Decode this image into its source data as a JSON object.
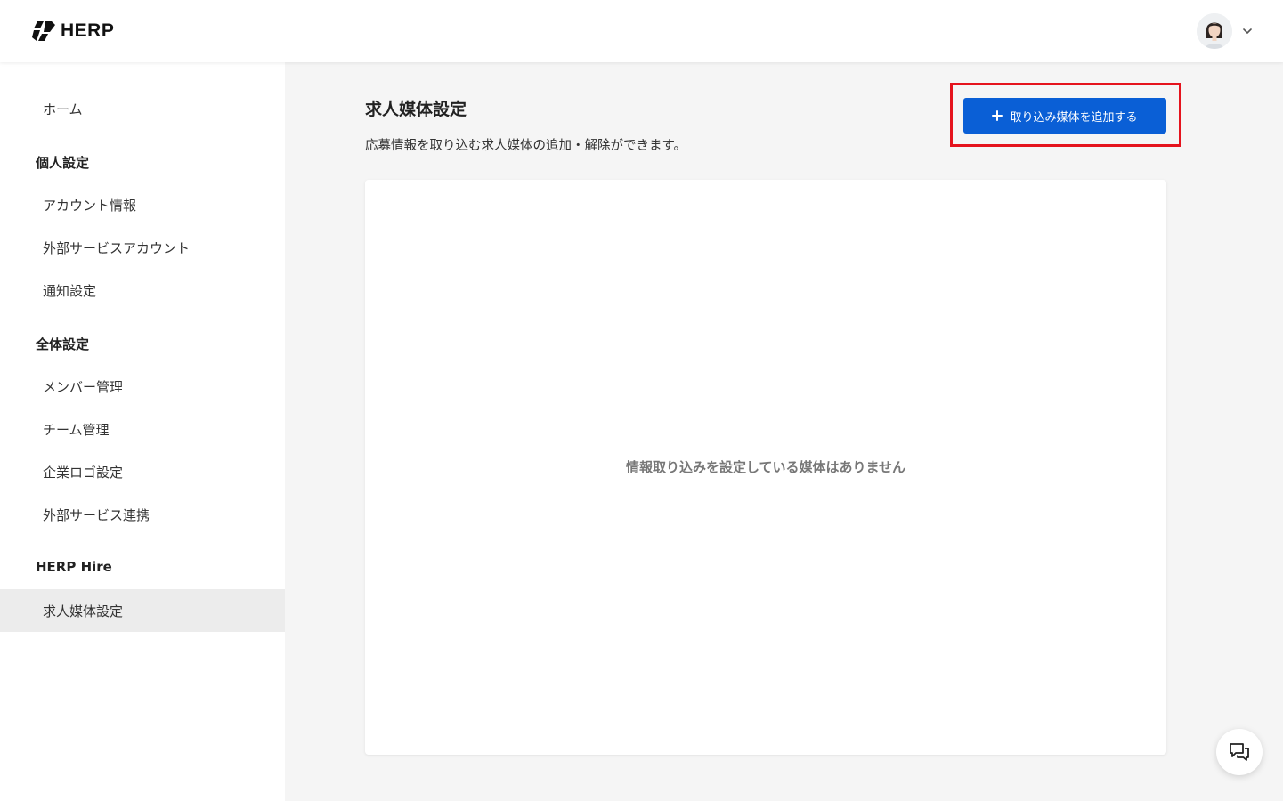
{
  "header": {
    "logo_text": "HERP",
    "user_menu_icon": "chevron-down-icon"
  },
  "sidebar": {
    "home_label": "ホーム",
    "personal_settings": {
      "heading": "個人設定",
      "items": [
        "アカウント情報",
        "外部サービスアカウント",
        "通知設定"
      ]
    },
    "global_settings": {
      "heading": "全体設定",
      "items": [
        "メンバー管理",
        "チーム管理",
        "企業ロゴ設定",
        "外部サービス連携"
      ]
    },
    "herp_hire": {
      "heading": "HERP Hire",
      "items": [
        "求人媒体設定"
      ],
      "active_item": "求人媒体設定"
    }
  },
  "main": {
    "title": "求人媒体設定",
    "description": "応募情報を取り込む求人媒体の追加・解除ができます。",
    "add_button_label": "取り込み媒体を追加する",
    "empty_message": "情報取り込みを設定している媒体はありません"
  },
  "colors": {
    "primary": "#0a5fd6",
    "highlight": "#e5131d",
    "background": "#f5f5f5",
    "active_nav": "#ececec"
  },
  "icons": {
    "add": "plus-icon",
    "chat": "chat-icon"
  }
}
